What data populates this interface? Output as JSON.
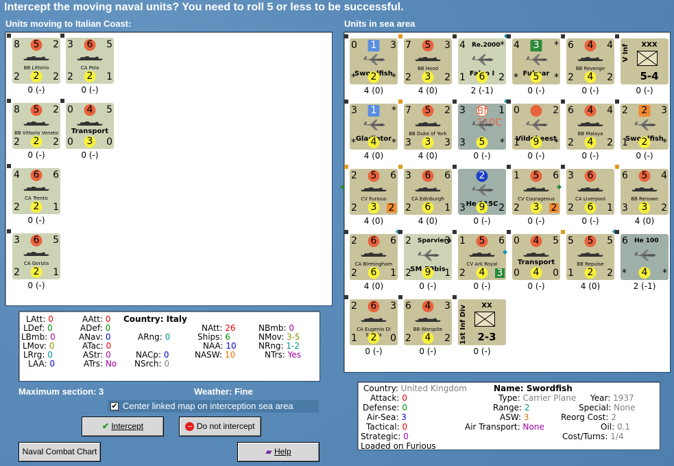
{
  "title": "Intercept the moving naval units?  You need to roll 5 or less to be successful.",
  "left_header": "Units moving to Italian Coast:",
  "right_header": "Units in sea area",
  "left_units": [
    {
      "tl": "8",
      "tc": "5",
      "tr": "2",
      "name": "BB Littorio",
      "bl": "2",
      "bc": "2",
      "br": "2",
      "below": "0 (-)"
    },
    {
      "tl": "3",
      "tc": "6",
      "tr": "5",
      "name": "CA Pola",
      "bl": "2",
      "bc": "2",
      "br": "1",
      "below": "0 (-)"
    },
    {
      "tl": "8",
      "tc": "5",
      "tr": "2",
      "name": "BB Vittorio Veneto",
      "bl": "2",
      "bc": "2",
      "br": "2",
      "below": "0 (-)"
    },
    {
      "tl": "0",
      "tc": "4",
      "tr": "5",
      "name": "Transport",
      "bl": "0",
      "bc": "3",
      "br": "0",
      "below": "0 (-)"
    },
    {
      "tl": "4",
      "tc": "6",
      "tr": "6",
      "name": "CA Trento",
      "bl": "2",
      "bc": "2",
      "br": "1",
      "below": "0 (-)"
    },
    {
      "tl": "3",
      "tc": "6",
      "tr": "5",
      "name": "CA Gorizia",
      "bl": "2",
      "bc": "2",
      "br": "1",
      "below": "0 (-)"
    }
  ],
  "sea_units": [
    {
      "tl": "0",
      "tc": "1",
      "tr": "3",
      "name": "Swordfish",
      "bl": "*",
      "bc": "2",
      "br": "*",
      "below": "4 (0)"
    },
    {
      "tl": "7",
      "tc": "5",
      "tr": "3",
      "name": "BB Hood",
      "bl": "2",
      "bc": "3",
      "br": "2",
      "below": "4 (0)"
    },
    {
      "tl": "4",
      "tc": "Re.2000",
      "tr": "*",
      "name": "Falco I",
      "bl": "1",
      "bc": "6",
      "br": "2",
      "below": "2 (-1)"
    },
    {
      "tl": "4",
      "tc": "3",
      "tr": "*",
      "name": "Fulmar",
      "bl": "*",
      "bc": "5",
      "br": "*",
      "below": "0 (-)"
    },
    {
      "tl": "6",
      "tc": "4",
      "tr": "4",
      "name": "BB Revenge",
      "bl": "2",
      "bc": "4",
      "br": "2",
      "below": "0 (-)"
    },
    {
      "tl": "V Inf",
      "tc": "XXX",
      "tr": "",
      "name": "5-4",
      "bl": "",
      "bc": "",
      "br": "",
      "below": "0 (-)"
    },
    {
      "tl": "3",
      "tc": "1",
      "tr": "*",
      "name": "Gladiator",
      "bl": "*",
      "bc": "4",
      "br": "*",
      "below": "4 (0)"
    },
    {
      "tl": "7",
      "tc": "5",
      "tr": "2",
      "name": "BB Duke of York",
      "bl": "3",
      "bc": "3",
      "br": "3",
      "below": "4 (0)"
    },
    {
      "tl": "3",
      "tc": "Bf 110C",
      "tr": "1",
      "name": "",
      "bl": "3",
      "bc": "5",
      "br": "*",
      "below": "0 (-)"
    },
    {
      "tl": "0",
      "tc": "",
      "tr": "2",
      "name": "Vildebeest",
      "bl": "1",
      "bc": "9",
      "br": "*",
      "below": "0 (-)"
    },
    {
      "tl": "6",
      "tc": "4",
      "tr": "4",
      "name": "BB Malaya",
      "bl": "2",
      "bc": "4",
      "br": "2",
      "below": "0 (-)"
    },
    {
      "tl": "2",
      "tc": "2",
      "tr": "3",
      "name": "Swordfish",
      "bl": "1",
      "bc": "2",
      "br": "*",
      "below": "0 (-)"
    },
    {
      "tl": "2",
      "tc": "5",
      "tr": "6",
      "name": "CV Furious",
      "bl": "2",
      "bc": "3",
      "br": "2",
      "below": "4 (0)"
    },
    {
      "tl": "3",
      "tc": "6",
      "tr": "6",
      "name": "CA Edinburgh",
      "bl": "2",
      "bc": "6",
      "br": "1",
      "below": "4 (0)"
    },
    {
      "tl": "",
      "tc": "2",
      "tr": "",
      "name": "He 115C",
      "bl": "3",
      "bc": "9",
      "br": "2",
      "below": "0 (-)"
    },
    {
      "tl": "1",
      "tc": "5",
      "tr": "6",
      "name": "CV Courageous",
      "bl": "2",
      "bc": "3",
      "br": "2",
      "below": "0 (-)"
    },
    {
      "tl": "3",
      "tc": "6",
      "tr": "",
      "name": "CA Liverpool",
      "bl": "2",
      "bc": "6",
      "br": "1",
      "below": "0 (-)"
    },
    {
      "tl": "6",
      "tc": "5",
      "tr": "4",
      "name": "BB Renown",
      "bl": "3",
      "bc": "3",
      "br": "2",
      "below": "4 (0)"
    },
    {
      "tl": "2",
      "tc": "6",
      "tr": "6",
      "name": "CA Birmingham",
      "bl": "2",
      "bc": "6",
      "br": "1",
      "below": "4 (0)"
    },
    {
      "tl": "2",
      "tc": "Sparviero",
      "tr": "3",
      "name": "SM.79bis",
      "bl": "2",
      "bc": "9",
      "br": "1",
      "below": "0 (-)"
    },
    {
      "tl": "1",
      "tc": "5",
      "tr": "6",
      "name": "CV Ark Royal",
      "bl": "2",
      "bc": "4",
      "br": "3",
      "below": "0 (-)"
    },
    {
      "tl": "0",
      "tc": "4",
      "tr": "5",
      "name": "Transport",
      "bl": "0",
      "bc": "4",
      "br": "0",
      "below": "0 (-)"
    },
    {
      "tl": "5",
      "tc": "5",
      "tr": "5",
      "name": "BB Repulse",
      "bl": "1",
      "bc": "2",
      "br": "2",
      "below": "4 (0)"
    },
    {
      "tl": "6",
      "tc": "He 100",
      "tr": "",
      "name": "",
      "bl": "*",
      "bc": "4",
      "br": "*",
      "below": "2 (-1)"
    },
    {
      "tl": "2",
      "tc": "6",
      "tr": "3",
      "name": "CA Eugenio Di Savoia",
      "bl": "1",
      "bc": "2",
      "br": "0",
      "below": "0 (-)"
    },
    {
      "tl": "6",
      "tc": "4",
      "tr": "3",
      "name": "BB Warspite",
      "bl": "2",
      "bc": "4",
      "br": "2",
      "below": "0 (-)"
    },
    {
      "tl": "1st Inf Div",
      "tc": "XX",
      "tr": "",
      "name": "2-3",
      "bl": "",
      "bc": "",
      "br": "",
      "below": "0 (-)"
    }
  ],
  "stats": {
    "latt_l": "LAtt:",
    "latt": "0",
    "aatt_l": "AAtt:",
    "aatt": "0",
    "country_l": "Country:",
    "country": "Italy",
    "ldef_l": "LDef:",
    "ldef": "0",
    "adef_l": "ADef:",
    "adef": "0",
    "natt_l": "NAtt:",
    "natt": "26",
    "nbmb_l": "NBmb:",
    "nbmb": "0",
    "lbmb_l": "LBmb:",
    "lbmb": "0",
    "anav_l": "ANav:",
    "anav": "0",
    "arng_l": "ARng:",
    "arng": "0",
    "ships_l": "Ships:",
    "ships": "6",
    "nmov_l": "NMov:",
    "nmov": "3-5",
    "lmov_l": "LMov:",
    "lmov": "0",
    "atac_l": "ATac:",
    "atac": "0",
    "naa_l": "NAA:",
    "naa": "10",
    "nrng_l": "NRng:",
    "nrng": "1-2",
    "lrrg_l": "LRrg:",
    "lrrg": "0",
    "astr_l": "AStr:",
    "astr": "0",
    "nacp_l": "NACp:",
    "nacp": "0",
    "nasw_l": "NASW:",
    "nasw": "10",
    "ntrs_l": "NTrs:",
    "ntrs": "Yes",
    "laa_l": "LAA:",
    "laa": "0",
    "atrs_l": "ATrs:",
    "atrs": "No",
    "nsrch_l": "NSrch:",
    "nsrch": "0"
  },
  "max_section": "Maximum section: 3",
  "weather": "Weather:  Fine",
  "center_label": "Center linked map on interception sea area",
  "buttons": {
    "intercept": "Intercept",
    "no_intercept": "Do not intercept",
    "chart": "Naval Combat Chart",
    "help": "Help"
  },
  "info": {
    "country_l": "Country:",
    "country": "United Kingdom",
    "name_l": "Name:",
    "name": "Swordfish",
    "attack_l": "Attack:",
    "attack": "0",
    "type_l": "Type:",
    "type": "Carrier Plane",
    "year_l": "Year:",
    "year": "1937",
    "defense_l": "Defense:",
    "defense": "0",
    "range_l": "Range:",
    "range": "2",
    "special_l": "Special:",
    "special": "None",
    "airsea_l": "Air-Sea:",
    "airsea": "3",
    "asw_l": "ASW:",
    "asw": "3",
    "reorg_l": "Reorg Cost:",
    "reorg": "2",
    "tactical_l": "Tactical:",
    "tactical": "0",
    "airtrans_l": "Air Transport:",
    "airtrans": "None",
    "oil_l": "Oil:",
    "oil": "0.1",
    "strategic_l": "Strategic:",
    "strategic": "0",
    "cost_l": "Cost/Turns:",
    "cost": "1/4",
    "loaded": "Loaded on Furious"
  },
  "colors": {
    "background": "#5f8fbc",
    "ship_counter": "#c2b99a",
    "italian_counter": "#cdd4b6"
  }
}
